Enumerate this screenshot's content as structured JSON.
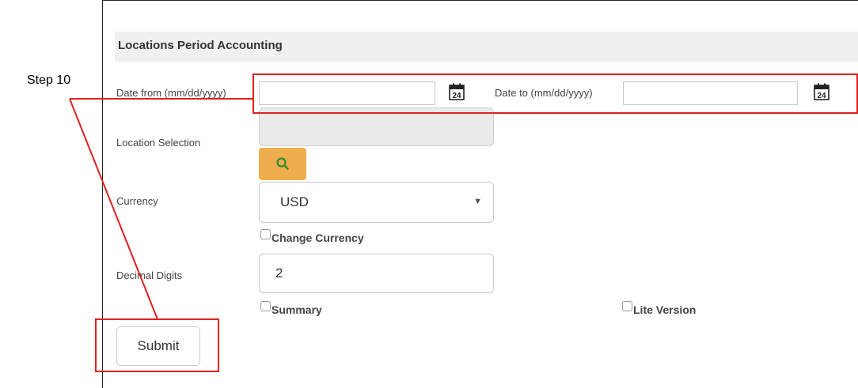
{
  "form": {
    "title": "Locations Period Accounting",
    "date_from_label": "Date from (mm/dd/yyyy)",
    "date_from_value": "",
    "date_to_label": "Date to (mm/dd/yyyy)",
    "date_to_value": "",
    "calendar_icon_day": "24",
    "location_label": "Location Selection",
    "currency_label": "Currency",
    "currency_value": "USD",
    "change_currency_label": "Change Currency",
    "decimal_label": "Decimal Digits",
    "decimal_value": "2",
    "summary_label": "Summary",
    "lite_label": "Lite Version",
    "submit_label": "Submit"
  },
  "annotation": {
    "step_label": "Step 10",
    "color": "#e02020"
  },
  "icons": {
    "calendar": "calendar-icon",
    "search": "search-icon",
    "dropdown": "chevron-down-icon"
  },
  "colors": {
    "search_button": "#f0ad4e",
    "search_icon": "#2e8b2e",
    "header_bg": "#f0f0f0"
  }
}
